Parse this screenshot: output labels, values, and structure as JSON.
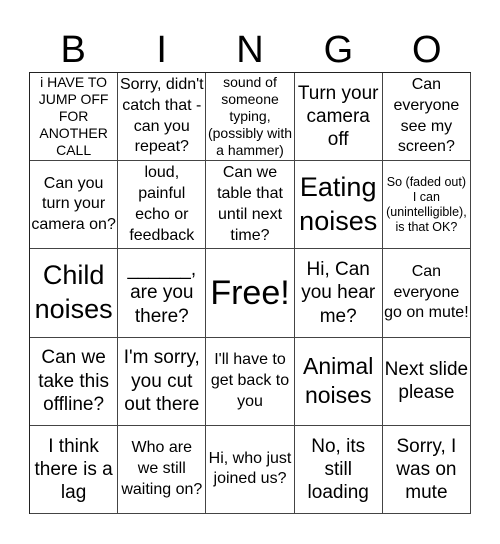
{
  "header": {
    "letters": [
      "B",
      "I",
      "N",
      "G",
      "O"
    ]
  },
  "board": {
    "cells": [
      [
        "i HAVE TO JUMP OFF FOR ANOTHER CALL",
        "Sorry, didn't catch that - can you repeat?",
        "sound of someone typing, (possibly with a hammer)",
        "Turn your camera off",
        "Can everyone see my screen?"
      ],
      [
        "Can you turn your camera on?",
        "loud, painful echo or feedback",
        "Can we table that until next time?",
        "Eating noises",
        "So (faded out) I can (unintelligible), is that OK?"
      ],
      [
        "Child noises",
        "______, are you there?",
        "Free!",
        "Hi, Can you hear me?",
        "Can everyone go on mute!"
      ],
      [
        "Can we take this offline?",
        "I'm sorry, you cut out there",
        "I'll have to get back to you",
        "Animal noises",
        "Next slide please"
      ],
      [
        "I think there is a lag",
        "Who are we still waiting on?",
        "Hi, who just joined us?",
        "No, its still loading",
        "Sorry, I was on mute"
      ]
    ]
  }
}
